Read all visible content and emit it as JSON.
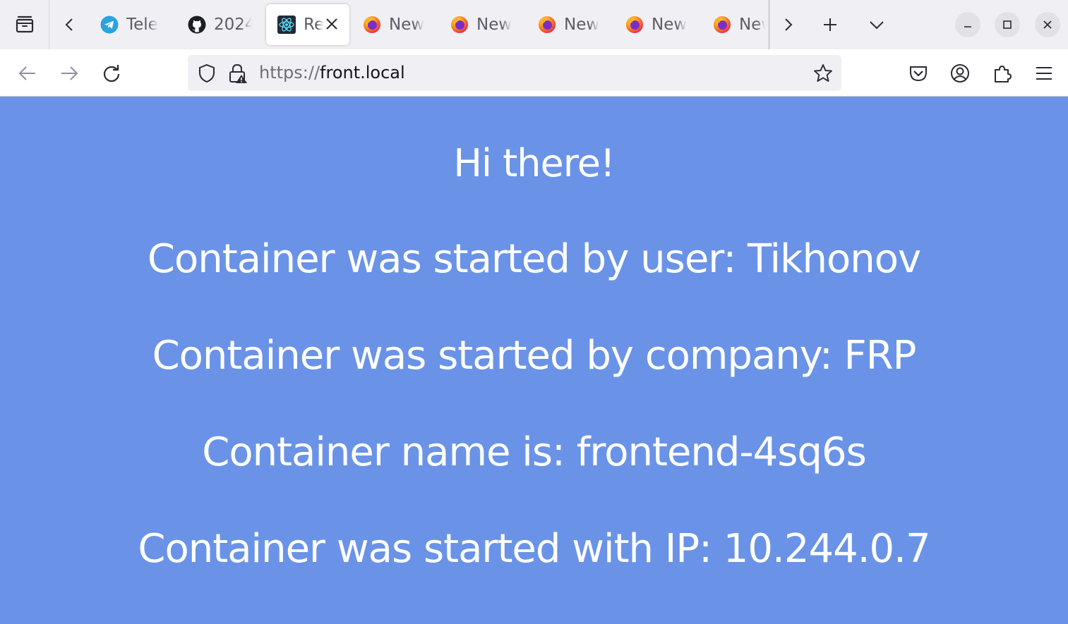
{
  "browser": {
    "tabs": [
      {
        "label": "Tele",
        "icon": "telegram-icon",
        "active": false
      },
      {
        "label": "2024",
        "icon": "github-icon",
        "active": false
      },
      {
        "label": "Re",
        "icon": "react-icon",
        "active": true
      },
      {
        "label": "New",
        "icon": "firefox-icon",
        "active": false
      },
      {
        "label": "New",
        "icon": "firefox-icon",
        "active": false
      },
      {
        "label": "New",
        "icon": "firefox-icon",
        "active": false
      },
      {
        "label": "New",
        "icon": "firefox-icon",
        "active": false
      },
      {
        "label": "New",
        "icon": "firefox-icon",
        "active": false
      }
    ],
    "url": {
      "scheme": "https://",
      "host": "front.local"
    }
  },
  "page": {
    "greeting": "Hi there!",
    "started_by_user": "Container was started by user: Tikhonov",
    "started_by_company": "Container was started by company: FRP",
    "container_name": "Container name is: frontend-4sq6s",
    "container_ip": "Container was started with IP: 10.244.0.7"
  },
  "colors": {
    "page_background": "#6a93e8",
    "page_text": "#ffffff",
    "chrome_background": "#f0f0f4"
  }
}
